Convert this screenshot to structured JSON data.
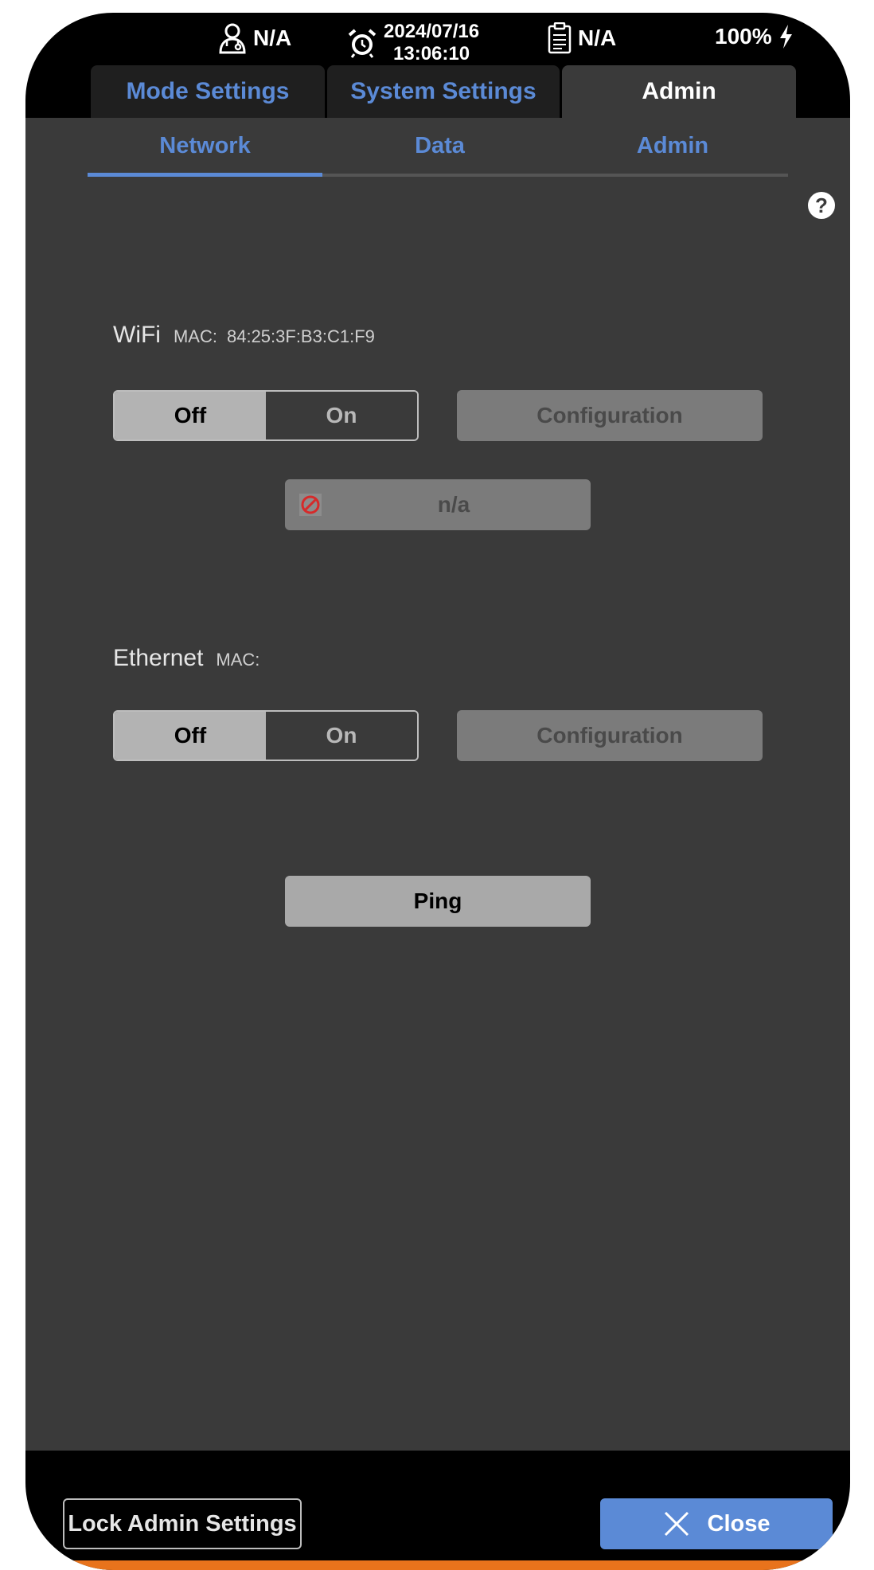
{
  "status_bar": {
    "user_value": "N/A",
    "date": "2024/07/16",
    "time": "13:06:10",
    "record_value": "N/A",
    "battery": "100%"
  },
  "top_tabs": [
    {
      "label": "Mode Settings",
      "active": false
    },
    {
      "label": "System Settings",
      "active": false
    },
    {
      "label": "Admin",
      "active": true
    }
  ],
  "sub_tabs": [
    {
      "label": "Network",
      "active": true
    },
    {
      "label": "Data",
      "active": false
    },
    {
      "label": "Admin",
      "active": false
    }
  ],
  "help_label": "?",
  "wifi": {
    "title": "WiFi",
    "mac_label": "MAC:",
    "mac_value": "84:25:3F:B3:C1:F9",
    "toggle_off": "Off",
    "toggle_on": "On",
    "state": "Off",
    "config_label": "Configuration",
    "network_value": "n/a"
  },
  "ethernet": {
    "title": "Ethernet",
    "mac_label": "MAC:",
    "mac_value": "",
    "toggle_off": "Off",
    "toggle_on": "On",
    "state": "Off",
    "config_label": "Configuration"
  },
  "ping_label": "Ping",
  "footer": {
    "lock_label": "Lock Admin Settings",
    "close_label": "Close"
  },
  "colors": {
    "accent": "#5b8ad6",
    "panel": "#3a3a3a",
    "alert": "#e8731c",
    "ban": "#d62a2a"
  }
}
